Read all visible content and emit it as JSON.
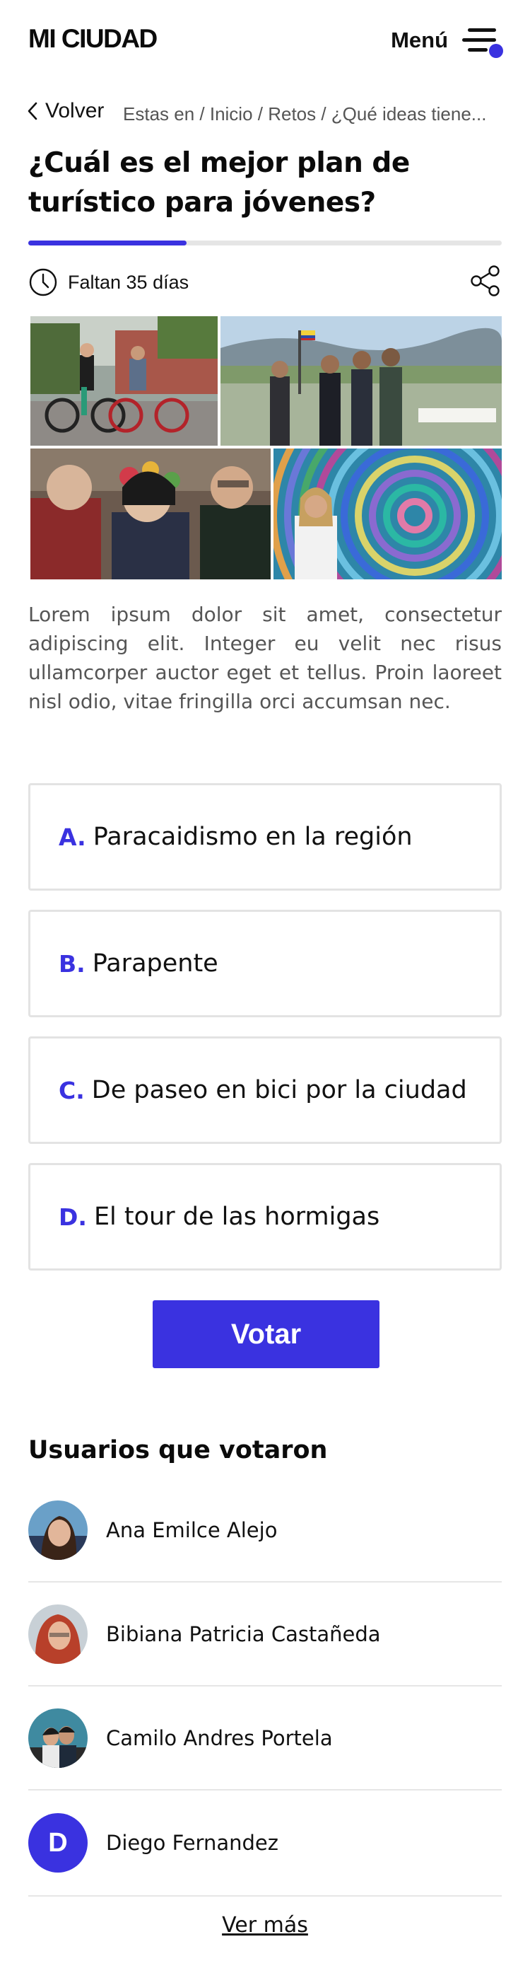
{
  "header": {
    "logo": "MI CIUDAD",
    "menu_label": "Menú",
    "menu_icon": "hamburger-menu-icon",
    "accent_color": "#3a32e0"
  },
  "nav": {
    "back_label": "Volver",
    "back_icon": "chevron-left-icon",
    "breadcrumb": "Estas en / Inicio / Retos / ¿Qué ideas tiene..."
  },
  "challenge": {
    "title": "¿Cuál es el mejor plan de turístico para jóvenes?",
    "progress_fraction": 0.335,
    "countdown": "Faltan 35 días",
    "clock_icon": "clock-icon",
    "share_icon": "share-icon",
    "description": "Lorem ipsum dolor sit amet, consectetur adipiscing elit. Integer eu velit nec risus ullamcorper auctor eget et tellus. Proin laoreet nisl odio, vitae fringilla orci accumsan nec."
  },
  "options": [
    {
      "letter": "A.",
      "text": "Paracaidismo en la región"
    },
    {
      "letter": "B.",
      "text": "Parapente"
    },
    {
      "letter": "C.",
      "text": "De paseo en bici por la ciudad"
    },
    {
      "letter": "D.",
      "text": "El tour de las hormigas"
    }
  ],
  "vote_button": "Votar",
  "voters": {
    "title": "Usuarios que votaron",
    "list": [
      {
        "name": "Ana Emilce Alejo"
      },
      {
        "name": "Bibiana Patricia Castañeda"
      },
      {
        "name": "Camilo Andres Portela"
      },
      {
        "name": "Diego Fernandez",
        "initial": "D"
      }
    ],
    "more_label": "Ver más"
  }
}
